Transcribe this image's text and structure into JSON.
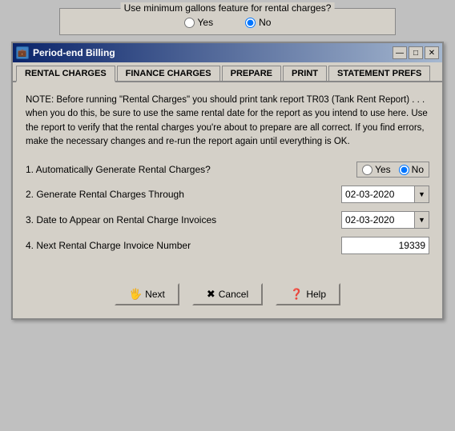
{
  "topbar": {
    "legend": "Use minimum gallons feature for rental charges?",
    "yes_label": "Yes",
    "no_label": "No"
  },
  "window": {
    "title": "Period-end Billing",
    "title_icon": "💼"
  },
  "tabs": [
    {
      "id": "rental-charges",
      "label": "RENTAL CHARGES",
      "active": true
    },
    {
      "id": "finance-charges",
      "label": "FINANCE CHARGES",
      "active": false
    },
    {
      "id": "prepare",
      "label": "PREPARE",
      "active": false
    },
    {
      "id": "print",
      "label": "PRINT",
      "active": false
    },
    {
      "id": "statement-prefs",
      "label": "STATEMENT PREFS",
      "active": false
    }
  ],
  "content": {
    "note": "NOTE: Before running \"Rental Charges\" you should print tank report TR03 (Tank Rent Report) . . . when you do this, be sure to use the same rental date for the report as you intend to use here.  Use the report to verify that the rental charges you're about to prepare are all correct.  If you find errors, make the necessary changes and re-run the report again until everything is OK.",
    "fields": [
      {
        "id": "auto-generate",
        "label": "1. Automatically Generate Rental Charges?",
        "type": "radio",
        "yes_label": "Yes",
        "no_label": "No",
        "value": "No"
      },
      {
        "id": "generate-through",
        "label": "2. Generate Rental Charges Through",
        "type": "date",
        "value": "02-03-2020"
      },
      {
        "id": "date-appear",
        "label": "3. Date to Appear on Rental Charge Invoices",
        "type": "date",
        "value": "02-03-2020"
      },
      {
        "id": "invoice-number",
        "label": "4. Next Rental Charge Invoice Number",
        "type": "number",
        "value": "19339"
      }
    ]
  },
  "buttons": [
    {
      "id": "next",
      "label": "Next",
      "icon": "🖐"
    },
    {
      "id": "cancel",
      "label": "Cancel",
      "icon": "✖"
    },
    {
      "id": "help",
      "label": "Help",
      "icon": "❓"
    }
  ],
  "title_controls": {
    "minimize": "—",
    "maximize": "□",
    "close": "✕"
  }
}
